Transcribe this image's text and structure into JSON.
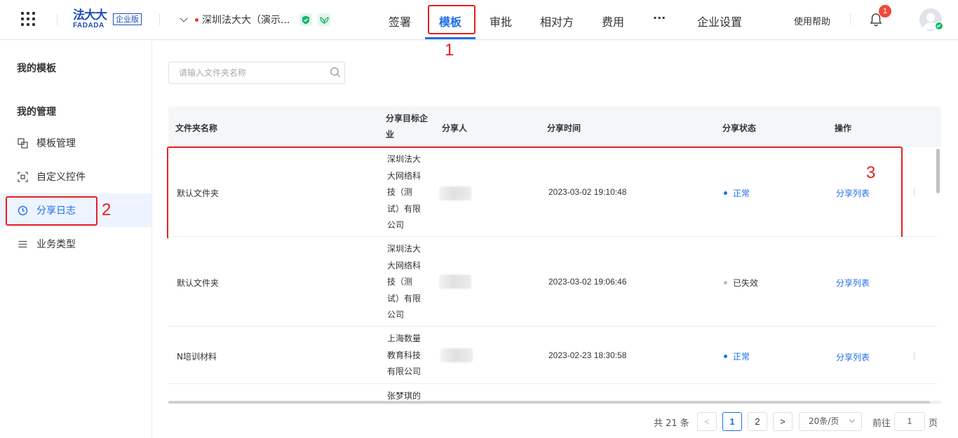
{
  "header": {
    "logo_cn": "法大大",
    "logo_en": "FADADA",
    "logo_badge": "企业版",
    "company": "深圳法大大（演示...",
    "nav": [
      {
        "label": "签署"
      },
      {
        "label": "模板",
        "active": true
      },
      {
        "label": "审批"
      },
      {
        "label": "相对方"
      },
      {
        "label": "费用"
      },
      {
        "label": "···"
      },
      {
        "label": "企业设置"
      }
    ],
    "help": "使用帮助",
    "notification_count": "1",
    "accent_color": "#1e6fe8"
  },
  "annotations": {
    "n1": "1",
    "n2": "2",
    "n3": "3",
    "color": "#e52020"
  },
  "sidebar": {
    "my_templates": "我的模板",
    "my_management": "我的管理",
    "items": [
      {
        "label": "模板管理",
        "icon": "template-icon"
      },
      {
        "label": "自定义控件",
        "icon": "custom-control-icon"
      },
      {
        "label": "分享日志",
        "icon": "clock-icon",
        "active": true
      },
      {
        "label": "业务类型",
        "icon": "list-icon"
      }
    ]
  },
  "search": {
    "placeholder": "请输入文件夹名称"
  },
  "table": {
    "columns": [
      "文件夹名称",
      "分享目标企业",
      "分享人",
      "分享时间",
      "分享状态",
      "操作"
    ],
    "rows": [
      {
        "folder": "默认文件夹",
        "target": "深圳法大大网络科技（测试）有限公司",
        "time": "2023-03-02 19:10:48",
        "status": "正常",
        "action": "分享列表"
      },
      {
        "folder": "默认文件夹",
        "target": "深圳法大大网络科技（测试）有限公司",
        "time": "2023-03-02 19:06:46",
        "status": "已失效",
        "action": "分享列表"
      },
      {
        "folder": "N培训材料",
        "target": "上海数量教育科技有限公司",
        "time": "2023-02-23 18:30:58",
        "status": "正常",
        "action": "分享列表"
      },
      {
        "folder": "",
        "target": "张梦琪的",
        "time": "",
        "status": "",
        "action": ""
      }
    ]
  },
  "pagination": {
    "total": "共 21 条",
    "prev": "<",
    "pages": [
      "1",
      "2"
    ],
    "next": ">",
    "page_size": "20条/页",
    "goto_label": "前往",
    "goto_value": "1",
    "goto_suffix": "页"
  }
}
